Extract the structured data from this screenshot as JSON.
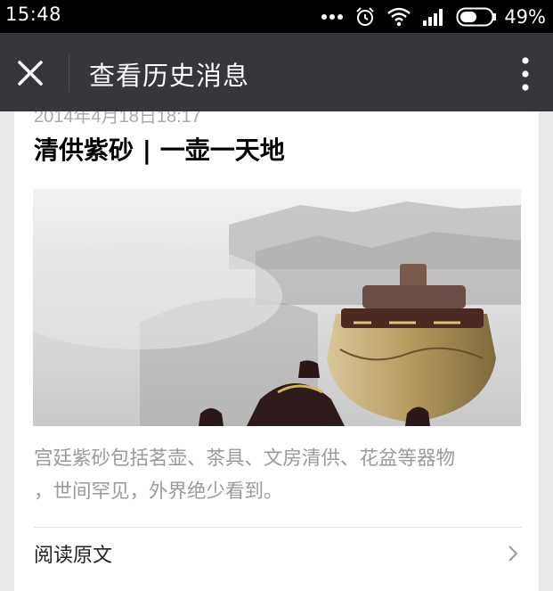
{
  "status_bar": {
    "time": "15:48",
    "battery_percent": "49%",
    "icons": [
      "more-dots-icon",
      "alarm-clock-icon",
      "wifi-icon",
      "signal-icon",
      "battery-icon"
    ]
  },
  "nav": {
    "close_icon": "close-icon",
    "title": "查看历史消息",
    "more_icon": "more-vertical-icon"
  },
  "post": {
    "date": "2014年4月18日18:17",
    "title": "清供紫砂 | 一壶一天地",
    "digest_line1": "宫廷紫砂包括茗壶、茶具、文房清供、花盆等器物",
    "digest_line2": "，世间罕见，外界绝少看到。",
    "read_more": "阅读原文"
  },
  "colors": {
    "status_bar_bg": "#000000",
    "nav_bg": "#36373a",
    "page_bg": "#e9e9e9",
    "card_bg": "#ffffff",
    "digest_text": "#9a9a9a"
  }
}
